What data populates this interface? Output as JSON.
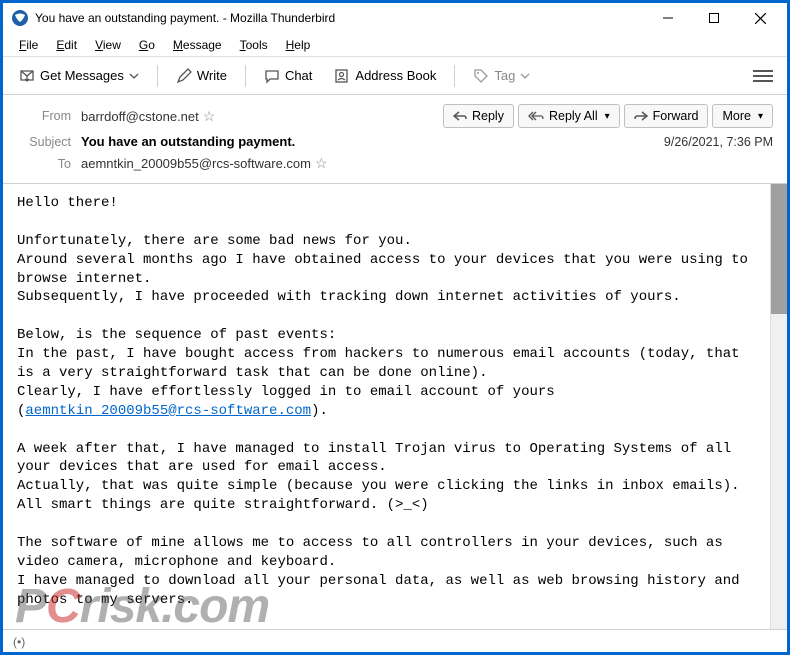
{
  "window": {
    "title": "You have an outstanding payment. - Mozilla Thunderbird"
  },
  "menubar": {
    "file": "File",
    "edit": "Edit",
    "view": "View",
    "go": "Go",
    "message": "Message",
    "tools": "Tools",
    "help": "Help"
  },
  "toolbar": {
    "get_messages": "Get Messages",
    "write": "Write",
    "chat": "Chat",
    "address_book": "Address Book",
    "tag": "Tag"
  },
  "header": {
    "from_label": "From",
    "from_value": "barrdoff@cstone.net",
    "subject_label": "Subject",
    "subject_value": "You have an outstanding payment.",
    "to_label": "To",
    "to_value": "aemntkin_20009b55@rcs-software.com",
    "date": "9/26/2021, 7:36 PM",
    "reply": "Reply",
    "reply_all": "Reply All",
    "forward": "Forward",
    "more": "More"
  },
  "body": {
    "greeting": "Hello there!",
    "p1": "Unfortunately, there are some bad news for you.\nAround several months ago I have obtained access to your devices that you were using to browse internet.\nSubsequently, I have proceeded with tracking down internet activities of yours.",
    "p2a": "Below, is the sequence of past events:\nIn the past, I have bought access from hackers to numerous email accounts (today, that is a very straightforward task that can be done online).\nClearly, I have effortlessly logged in to email account of yours (",
    "email_link": "aemntkin_20009b55@rcs-software.com",
    "p2b": ").",
    "p3": "A week after that, I have managed to install Trojan virus to Operating Systems of all your devices that are used for email access.\nActually, that was quite simple (because you were clicking the links in inbox emails).\nAll smart things are quite straightforward. (>_<)",
    "p4": "The software of mine allows me to access to all controllers in your devices, such as video camera, microphone and keyboard.\nI have managed to download all your personal data, as well as web browsing history and photos to my servers."
  },
  "statusbar": {
    "text": "(•)"
  },
  "watermark": {
    "p": "P",
    "c": "C",
    "rest": "risk.com"
  }
}
